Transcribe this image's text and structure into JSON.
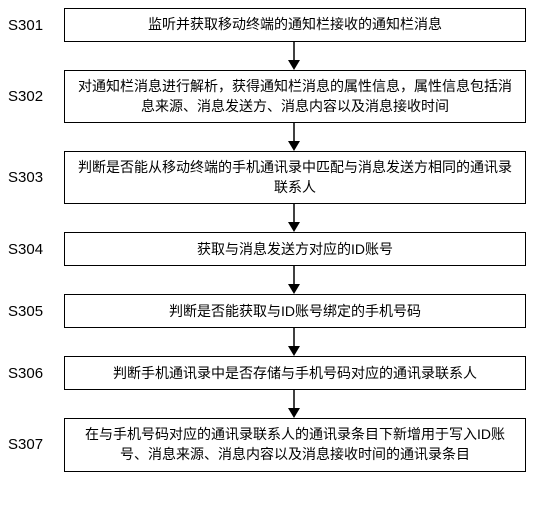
{
  "steps": [
    {
      "id": "S301",
      "text": "监听并获取移动终端的通知栏接收的通知栏消息",
      "lines": 1
    },
    {
      "id": "S302",
      "text": "对通知栏消息进行解析，获得通知栏消息的属性信息，属性信息包括消息来源、消息发送方、消息内容以及消息接收时间",
      "lines": 2
    },
    {
      "id": "S303",
      "text": "判断是否能从移动终端的手机通讯录中匹配与消息发送方相同的通讯录联系人",
      "lines": 2
    },
    {
      "id": "S304",
      "text": "获取与消息发送方对应的ID账号",
      "lines": 1
    },
    {
      "id": "S305",
      "text": "判断是否能获取与ID账号绑定的手机号码",
      "lines": 1
    },
    {
      "id": "S306",
      "text": "判断手机通讯录中是否存储与手机号码对应的通讯录联系人",
      "lines": 1
    },
    {
      "id": "S307",
      "text": "在与手机号码对应的通讯录联系人的通讯录条目下新增用于写入ID账号、消息来源、消息内容以及消息接收时间的通讯录条目",
      "lines": 2
    }
  ]
}
